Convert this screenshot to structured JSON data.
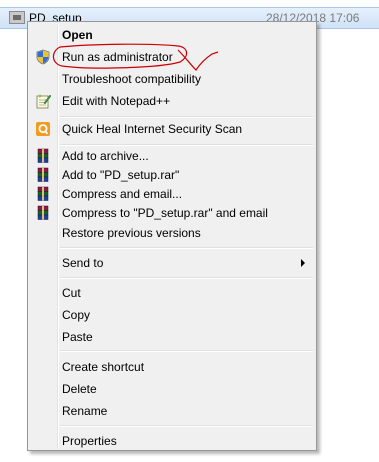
{
  "file": {
    "name": "PD_setup",
    "modified": "28/12/2018 17:06"
  },
  "menu": {
    "open": "Open",
    "run_as_admin": "Run as administrator",
    "troubleshoot": "Troubleshoot compatibility",
    "edit_notepad": "Edit with Notepad++",
    "quickheal_scan": "Quick Heal Internet Security Scan",
    "add_archive": "Add to archive...",
    "add_rar": "Add to \"PD_setup.rar\"",
    "compress_email": "Compress and email...",
    "compress_rar_email": "Compress to \"PD_setup.rar\" and email",
    "restore_versions": "Restore previous versions",
    "send_to": "Send to",
    "cut": "Cut",
    "copy": "Copy",
    "paste": "Paste",
    "create_shortcut": "Create shortcut",
    "delete": "Delete",
    "rename": "Rename",
    "properties": "Properties"
  },
  "icons": {
    "uac": "shield-icon",
    "notepad": "notepad-icon",
    "quickheal": "quickheal-icon",
    "winrar": "winrar-icon"
  },
  "colors": {
    "annotation": "#cc0000",
    "quickheal": "#f29b21",
    "selection_row": "#cfe2f7"
  }
}
